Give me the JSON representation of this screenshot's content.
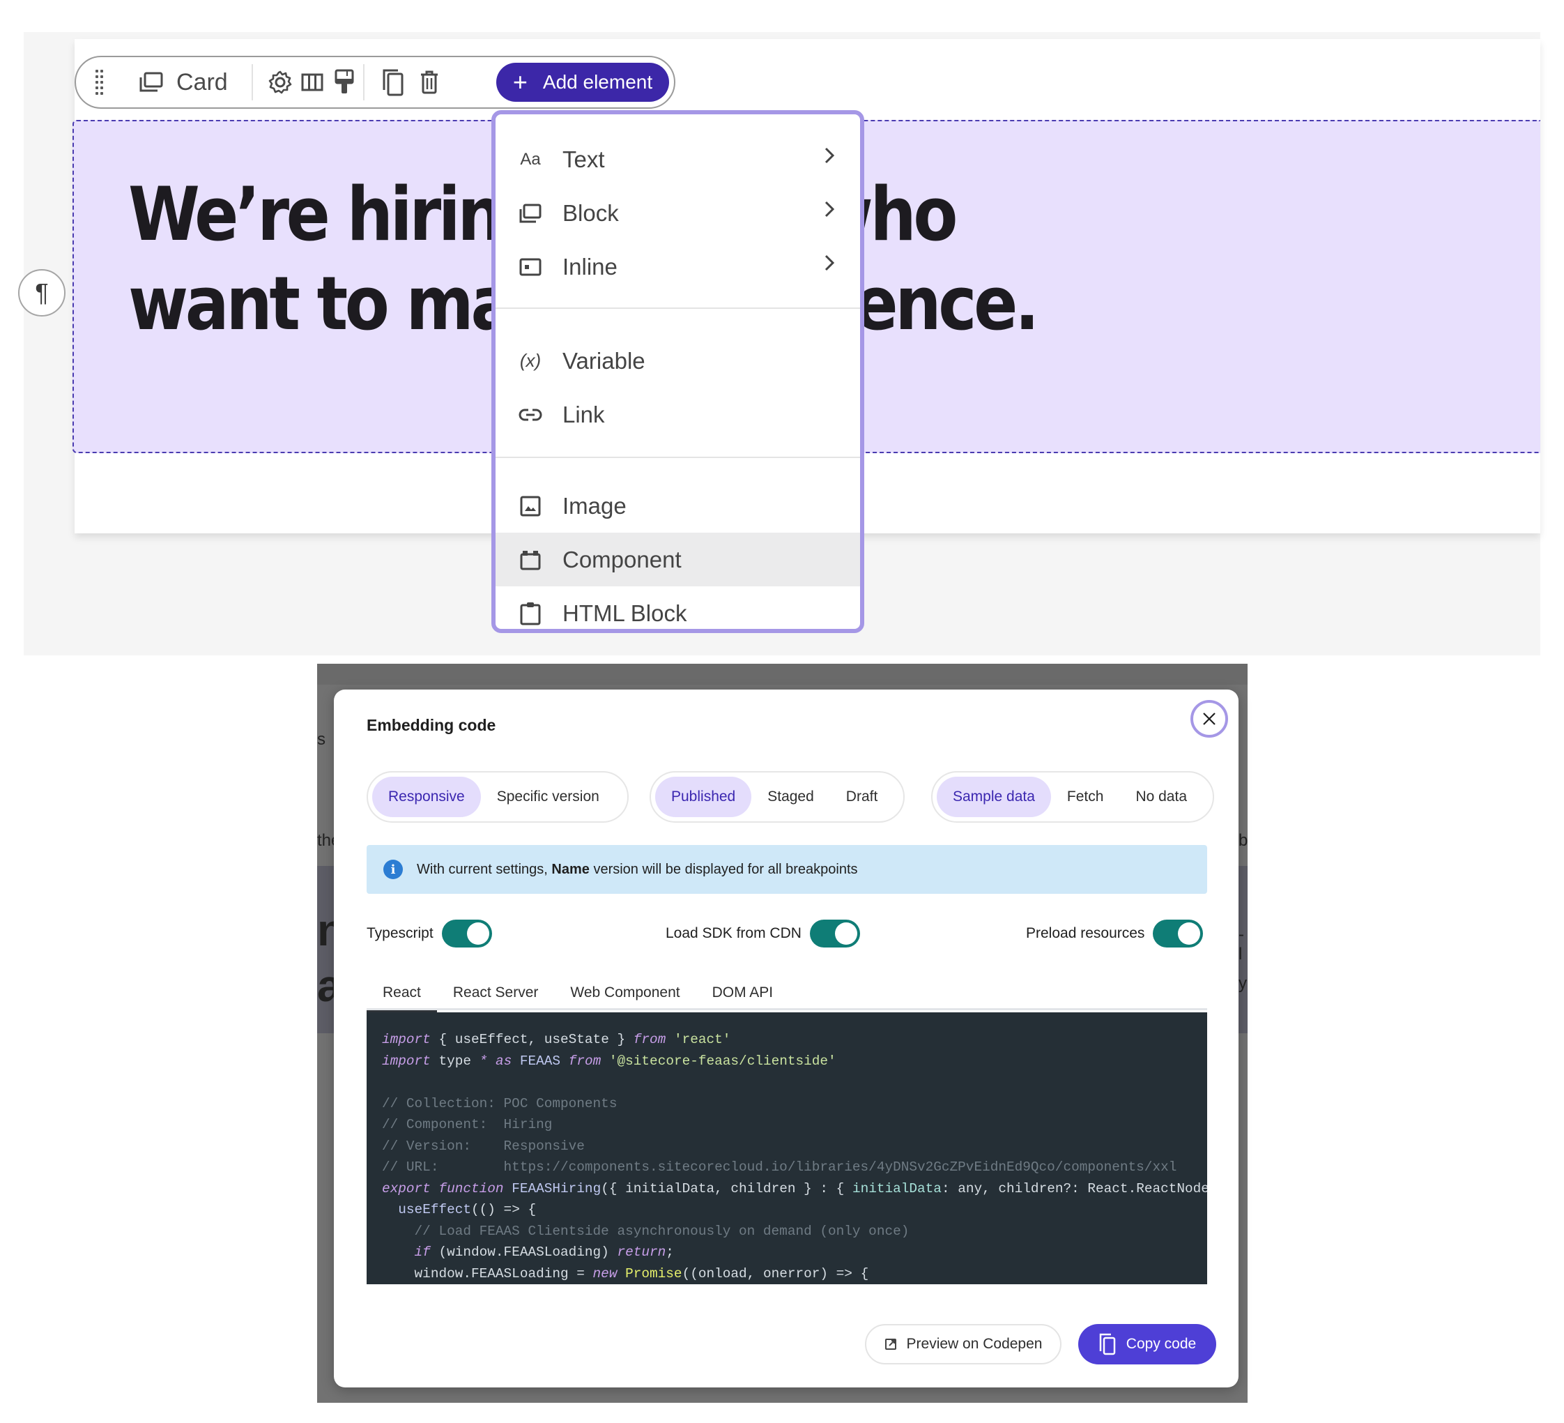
{
  "editor": {
    "toolbar": {
      "element_type_label": "Card",
      "icons": [
        "drag-handle-icon",
        "card-icon",
        "settings-gear-icon",
        "columns-icon",
        "paint-brush-icon",
        "duplicate-icon",
        "trash-icon"
      ],
      "add_element_label": "Add element",
      "add_icon": "+"
    },
    "hero": {
      "line1": "We’re hiring people who",
      "line2": "want to make a difference."
    },
    "paragraph_handle_glyph": "¶",
    "add_menu": {
      "groups": [
        [
          {
            "icon": "text-aa-icon",
            "glyph": "Aa",
            "label": "Text",
            "has_submenu": true
          },
          {
            "icon": "block-icon",
            "glyph": "",
            "label": "Block",
            "has_submenu": true
          },
          {
            "icon": "inline-icon",
            "glyph": "",
            "label": "Inline",
            "has_submenu": true
          }
        ],
        [
          {
            "icon": "variable-icon",
            "glyph": "(x)",
            "label": "Variable",
            "has_submenu": false
          },
          {
            "icon": "link-icon",
            "glyph": "",
            "label": "Link",
            "has_submenu": false
          }
        ],
        [
          {
            "icon": "image-icon",
            "glyph": "",
            "label": "Image",
            "has_submenu": false
          },
          {
            "icon": "component-icon",
            "glyph": "",
            "label": "Component",
            "has_submenu": false,
            "hovered": true
          },
          {
            "icon": "html-block-icon",
            "glyph": "",
            "label": "HTML Block",
            "has_submenu": false
          }
        ]
      ]
    }
  },
  "background_fragments": {
    "left_s": "s",
    "left_the": "the",
    "left_big_n": "ng",
    "left_big_a": "a",
    "right_b": "b",
    "right_l": "-l",
    "right_y": "y"
  },
  "modal": {
    "title": "Embedding code",
    "close_icon": "×",
    "segments": [
      {
        "options": [
          "Responsive",
          "Specific version"
        ],
        "selected": "Responsive"
      },
      {
        "options": [
          "Published",
          "Staged",
          "Draft"
        ],
        "selected": "Published"
      },
      {
        "options": [
          "Sample data",
          "Fetch",
          "No data"
        ],
        "selected": "Sample data"
      }
    ],
    "info": {
      "icon": "i",
      "text_before": "With current settings, ",
      "text_bold": "Name",
      "text_after": " version will be displayed for all breakpoints"
    },
    "toggles": [
      {
        "label": "Typescript",
        "on": true
      },
      {
        "label": "Load SDK from CDN",
        "on": true
      },
      {
        "label": "Preload resources",
        "on": true
      }
    ],
    "tabs": [
      "React",
      "React Server",
      "Web Component",
      "DOM API"
    ],
    "active_tab": "React",
    "code_lines": [
      [
        [
          "kw",
          "import"
        ],
        [
          "pl",
          " { useEffect, useState } "
        ],
        [
          "kw",
          "from"
        ],
        [
          "pl",
          " "
        ],
        [
          "str",
          "'react'"
        ]
      ],
      [
        [
          "kw",
          "import"
        ],
        [
          "pl",
          " type "
        ],
        [
          "kw",
          "*"
        ],
        [
          "pl",
          " "
        ],
        [
          "kw",
          "as"
        ],
        [
          "pl",
          " "
        ],
        [
          "idt",
          "FEAAS"
        ],
        [
          "pl",
          " "
        ],
        [
          "kw",
          "from"
        ],
        [
          "pl",
          " "
        ],
        [
          "str",
          "'@sitecore-feaas/clientside'"
        ]
      ],
      [
        [
          "pl",
          ""
        ]
      ],
      [
        [
          "cm",
          "// Collection: POC Components"
        ]
      ],
      [
        [
          "cm",
          "// Component:  Hiring"
        ]
      ],
      [
        [
          "cm",
          "// Version:    Responsive"
        ]
      ],
      [
        [
          "cm",
          "// URL:        https://components.sitecorecloud.io/libraries/4yDNSv2GcZPvEidnEd9Qco/components/xxl"
        ]
      ],
      [
        [
          "kw",
          "export"
        ],
        [
          "pl",
          " "
        ],
        [
          "kw",
          "function"
        ],
        [
          "pl",
          " "
        ],
        [
          "idt",
          "FEAASHiring"
        ],
        [
          "pl",
          "({ initialData, children } : { "
        ],
        [
          "ty",
          "initialData"
        ],
        [
          "pl",
          ": any, children?: React.ReactNode })"
        ]
      ],
      [
        [
          "pl",
          "  "
        ],
        [
          "idt",
          "useEffect"
        ],
        [
          "pl",
          "(() => {"
        ]
      ],
      [
        [
          "pl",
          "    "
        ],
        [
          "cm",
          "// Load FEAAS Clientside asynchronously on demand (only once)"
        ]
      ],
      [
        [
          "pl",
          "    "
        ],
        [
          "kw",
          "if"
        ],
        [
          "pl",
          " (window.FEAASLoading) "
        ],
        [
          "kw",
          "return"
        ],
        [
          "pl",
          ";"
        ]
      ],
      [
        [
          "pl",
          "    window.FEAASLoading = "
        ],
        [
          "kw",
          "new"
        ],
        [
          "pl",
          " "
        ],
        [
          "fn",
          "Promise"
        ],
        [
          "pl",
          "((onload, onerror) => {"
        ]
      ]
    ],
    "footer": {
      "preview_label": "Preview on Codepen",
      "copy_label": "Copy code"
    }
  },
  "colors": {
    "accent": "#3c27a8",
    "accent_button": "#4e3fd6",
    "hero_bg": "#e8e0fd",
    "menu_border": "#a597e6",
    "toggle_on": "#0f7d76",
    "info_bg": "#cfe8f8",
    "code_bg": "#252f36"
  }
}
